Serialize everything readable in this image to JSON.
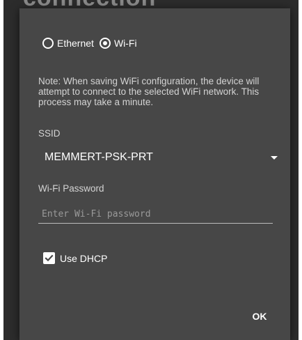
{
  "background": {
    "title_fragment": "connection"
  },
  "dialog": {
    "connection_type": {
      "options": [
        {
          "label": "Ethernet",
          "selected": false
        },
        {
          "label": "Wi-Fi",
          "selected": true
        }
      ]
    },
    "note": "Note: When saving WiFi configuration, the device will attempt to connect to the selected WiFi network. This process may take a minute.",
    "ssid": {
      "label": "SSID",
      "value": "MEMMERT-PSK-PRT"
    },
    "password": {
      "label": "Wi-Fi Password",
      "value": "",
      "placeholder": "Enter Wi-Fi password"
    },
    "dhcp": {
      "label": "Use DHCP",
      "checked": true
    },
    "ok_label": "OK"
  },
  "colors": {
    "screen_background": "#2c2c2c",
    "dialog_background": "#474747",
    "text_primary": "#ffffff",
    "text_secondary": "#d4d4d4"
  },
  "icons": {
    "ethernet_radio": "radio-unchecked-icon",
    "wifi_radio": "radio-checked-icon",
    "ssid_dropdown": "dropdown-arrow-icon",
    "dhcp_checkbox": "checkbox-checked-icon"
  }
}
